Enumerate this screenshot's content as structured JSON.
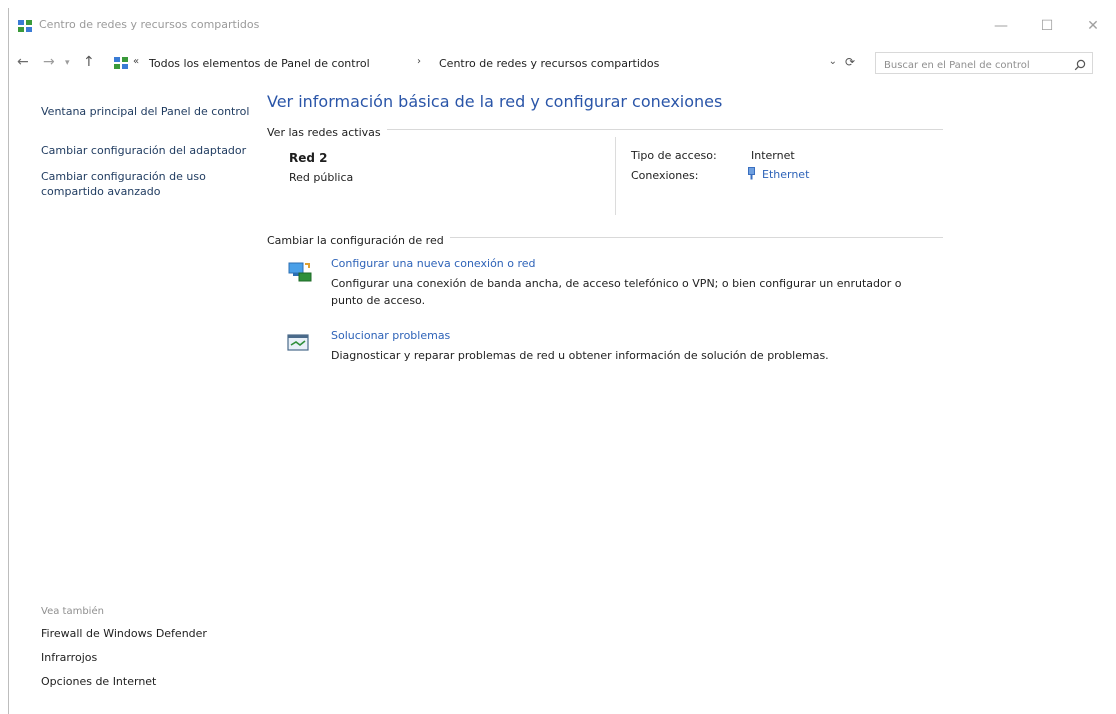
{
  "window": {
    "title": "Centro de redes y recursos compartidos",
    "controls": {
      "minimize": "—",
      "maximize": "☐",
      "close": "✕"
    }
  },
  "nav": {
    "back": "←",
    "forward": "→",
    "recent": "▾",
    "up": "↑",
    "overflow": "«",
    "breadcrumbs": [
      "Todos los elementos de Panel de control",
      "Centro de redes y recursos compartidos"
    ],
    "separator": "›",
    "search_placeholder": "Buscar en el Panel de control"
  },
  "sidebar": {
    "items": [
      {
        "label": "Ventana principal del Panel de control"
      },
      {
        "label": "Cambiar configuración del adaptador"
      },
      {
        "label": "Cambiar configuración de uso compartido avanzado"
      }
    ],
    "see_also_header": "Vea también",
    "see_also": [
      {
        "label": "Firewall de Windows Defender"
      },
      {
        "label": "Infrarrojos"
      },
      {
        "label": "Opciones de Internet"
      }
    ]
  },
  "main": {
    "title": "Ver información básica de la red y configurar conexiones",
    "active_networks_header": "Ver las redes activas",
    "network": {
      "name": "Red 2",
      "type": "Red pública",
      "access_label": "Tipo de acceso:",
      "access_value": "Internet",
      "connections_label": "Conexiones:",
      "connection_value": "Ethernet"
    },
    "change_header": "Cambiar la configuración de red",
    "tasks": [
      {
        "icon": "new-connection-icon",
        "link": "Configurar una nueva conexión o red",
        "description": "Configurar una conexión de banda ancha, de acceso telefónico o VPN; o bien configurar un enrutador o punto de acceso."
      },
      {
        "icon": "troubleshoot-icon",
        "link": "Solucionar problemas",
        "description": "Diagnosticar y reparar problemas de red u obtener información de solución de problemas."
      }
    ]
  },
  "colors": {
    "link": "#2e63b8",
    "title": "#2a55a8",
    "muted": "#8f8f8f"
  }
}
